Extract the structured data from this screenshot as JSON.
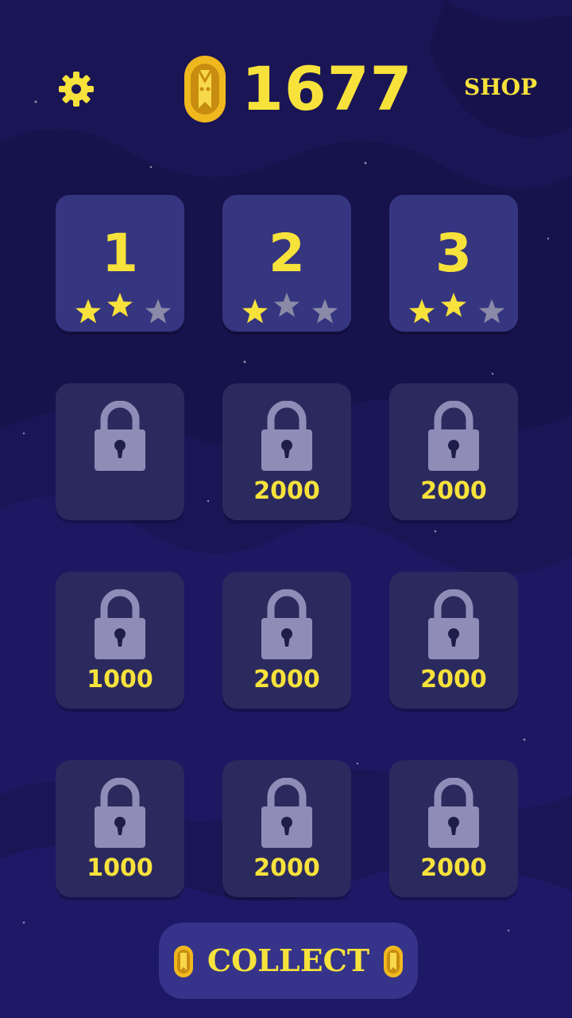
{
  "header": {
    "coins": "1677",
    "shop_label": "SHOP",
    "settings_icon": "gear-icon",
    "coin_icon": "coin-icon"
  },
  "levels": [
    {
      "label": "1",
      "status": "unlocked",
      "stars_earned": 2,
      "stars_total": 3
    },
    {
      "label": "2",
      "status": "unlocked",
      "stars_earned": 1,
      "stars_total": 3
    },
    {
      "label": "3",
      "status": "unlocked",
      "stars_earned": 2,
      "stars_total": 3
    },
    {
      "status": "locked",
      "cost": ""
    },
    {
      "status": "locked",
      "cost": "2000"
    },
    {
      "status": "locked",
      "cost": "2000"
    },
    {
      "status": "locked",
      "cost": "1000"
    },
    {
      "status": "locked",
      "cost": "2000"
    },
    {
      "status": "locked",
      "cost": "2000"
    },
    {
      "status": "locked",
      "cost": "1000"
    },
    {
      "status": "locked",
      "cost": "2000"
    },
    {
      "status": "locked",
      "cost": "2000"
    }
  ],
  "footer": {
    "collect_label": "COLLECT"
  },
  "colors": {
    "background": "#1a1555",
    "accent_yellow": "#f7e23b",
    "tile_unlocked": "#363580",
    "tile_locked": "#2b2a5e",
    "star_empty": "#8a8aa8",
    "lock": "#8f8db8"
  }
}
